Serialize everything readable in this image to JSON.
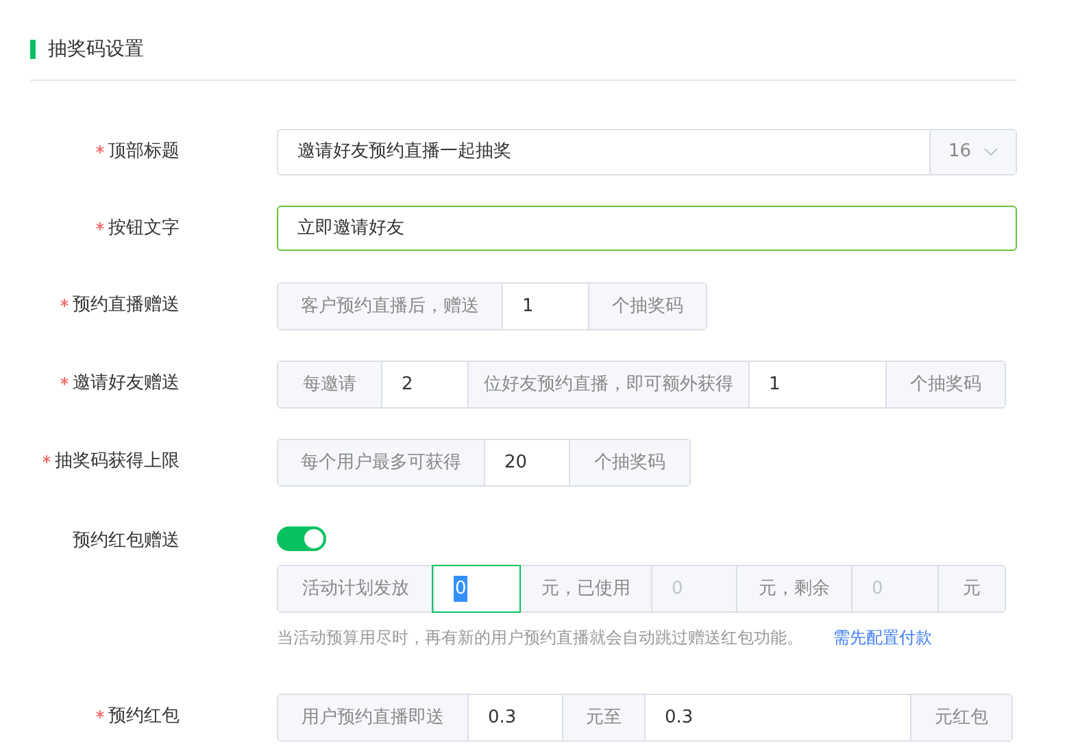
{
  "section": {
    "title": "抽奖码设置"
  },
  "fields": [
    {
      "kind": "text_select",
      "label": "顶部标题",
      "required": true,
      "value": "邀请好友预约直播一起抽奖",
      "focused": false,
      "select": "16"
    },
    {
      "kind": "text",
      "label": "按钮文字",
      "required": true,
      "value": "立即邀请好友",
      "focused": true
    },
    {
      "kind": "group",
      "label": "预约直播赠送",
      "required": true,
      "segments": [
        {
          "kind": "addon",
          "text": "客户预约直播后，赠送"
        },
        {
          "kind": "input",
          "value": "1",
          "focused": false,
          "disabled": false
        },
        {
          "kind": "addon",
          "text": "个抽奖码"
        }
      ]
    },
    {
      "kind": "group",
      "label": "邀请好友赠送",
      "required": true,
      "segments": [
        {
          "kind": "addon",
          "text": "每邀请"
        },
        {
          "kind": "input",
          "value": "2",
          "focused": false,
          "disabled": false
        },
        {
          "kind": "addon",
          "text": "位好友预约直播，即可额外获得"
        },
        {
          "kind": "input",
          "value": "1",
          "focused": false,
          "disabled": false
        },
        {
          "kind": "addon",
          "text": "个抽奖码"
        }
      ]
    },
    {
      "kind": "group",
      "label": "抽奖码获得上限",
      "required": true,
      "segments": [
        {
          "kind": "addon",
          "text": "每个用户最多可获得"
        },
        {
          "kind": "input",
          "value": "20",
          "focused": false,
          "disabled": false
        },
        {
          "kind": "addon",
          "text": "个抽奖码"
        }
      ]
    },
    {
      "kind": "switch",
      "label": "预约红包赠送",
      "required": false,
      "on": true,
      "segments": [
        {
          "kind": "addon",
          "text": "活动计划发放"
        },
        {
          "kind": "input",
          "value": "0",
          "focused": true,
          "disabled": false
        },
        {
          "kind": "addon",
          "text": "元，已使用"
        },
        {
          "kind": "input",
          "value": "0",
          "focused": false,
          "disabled": true
        },
        {
          "kind": "addon",
          "text": "元，剩余"
        },
        {
          "kind": "input",
          "value": "0",
          "focused": false,
          "disabled": true
        },
        {
          "kind": "addon",
          "text": "元"
        }
      ],
      "note": "当活动预算用尽时，再有新的用户预约直播就会自动跳过赠送红包功能。",
      "link": "需先配置付款"
    },
    {
      "kind": "group",
      "label": "预约红包",
      "required": true,
      "segments": [
        {
          "kind": "addon",
          "text": "用户预约直播即送"
        },
        {
          "kind": "input",
          "value": "0.3",
          "focused": false,
          "disabled": false
        },
        {
          "kind": "addon",
          "text": "元至"
        },
        {
          "kind": "input",
          "value": "0.3",
          "focused": false,
          "disabled": false
        },
        {
          "kind": "addon",
          "text": "元红包"
        }
      ]
    }
  ]
}
